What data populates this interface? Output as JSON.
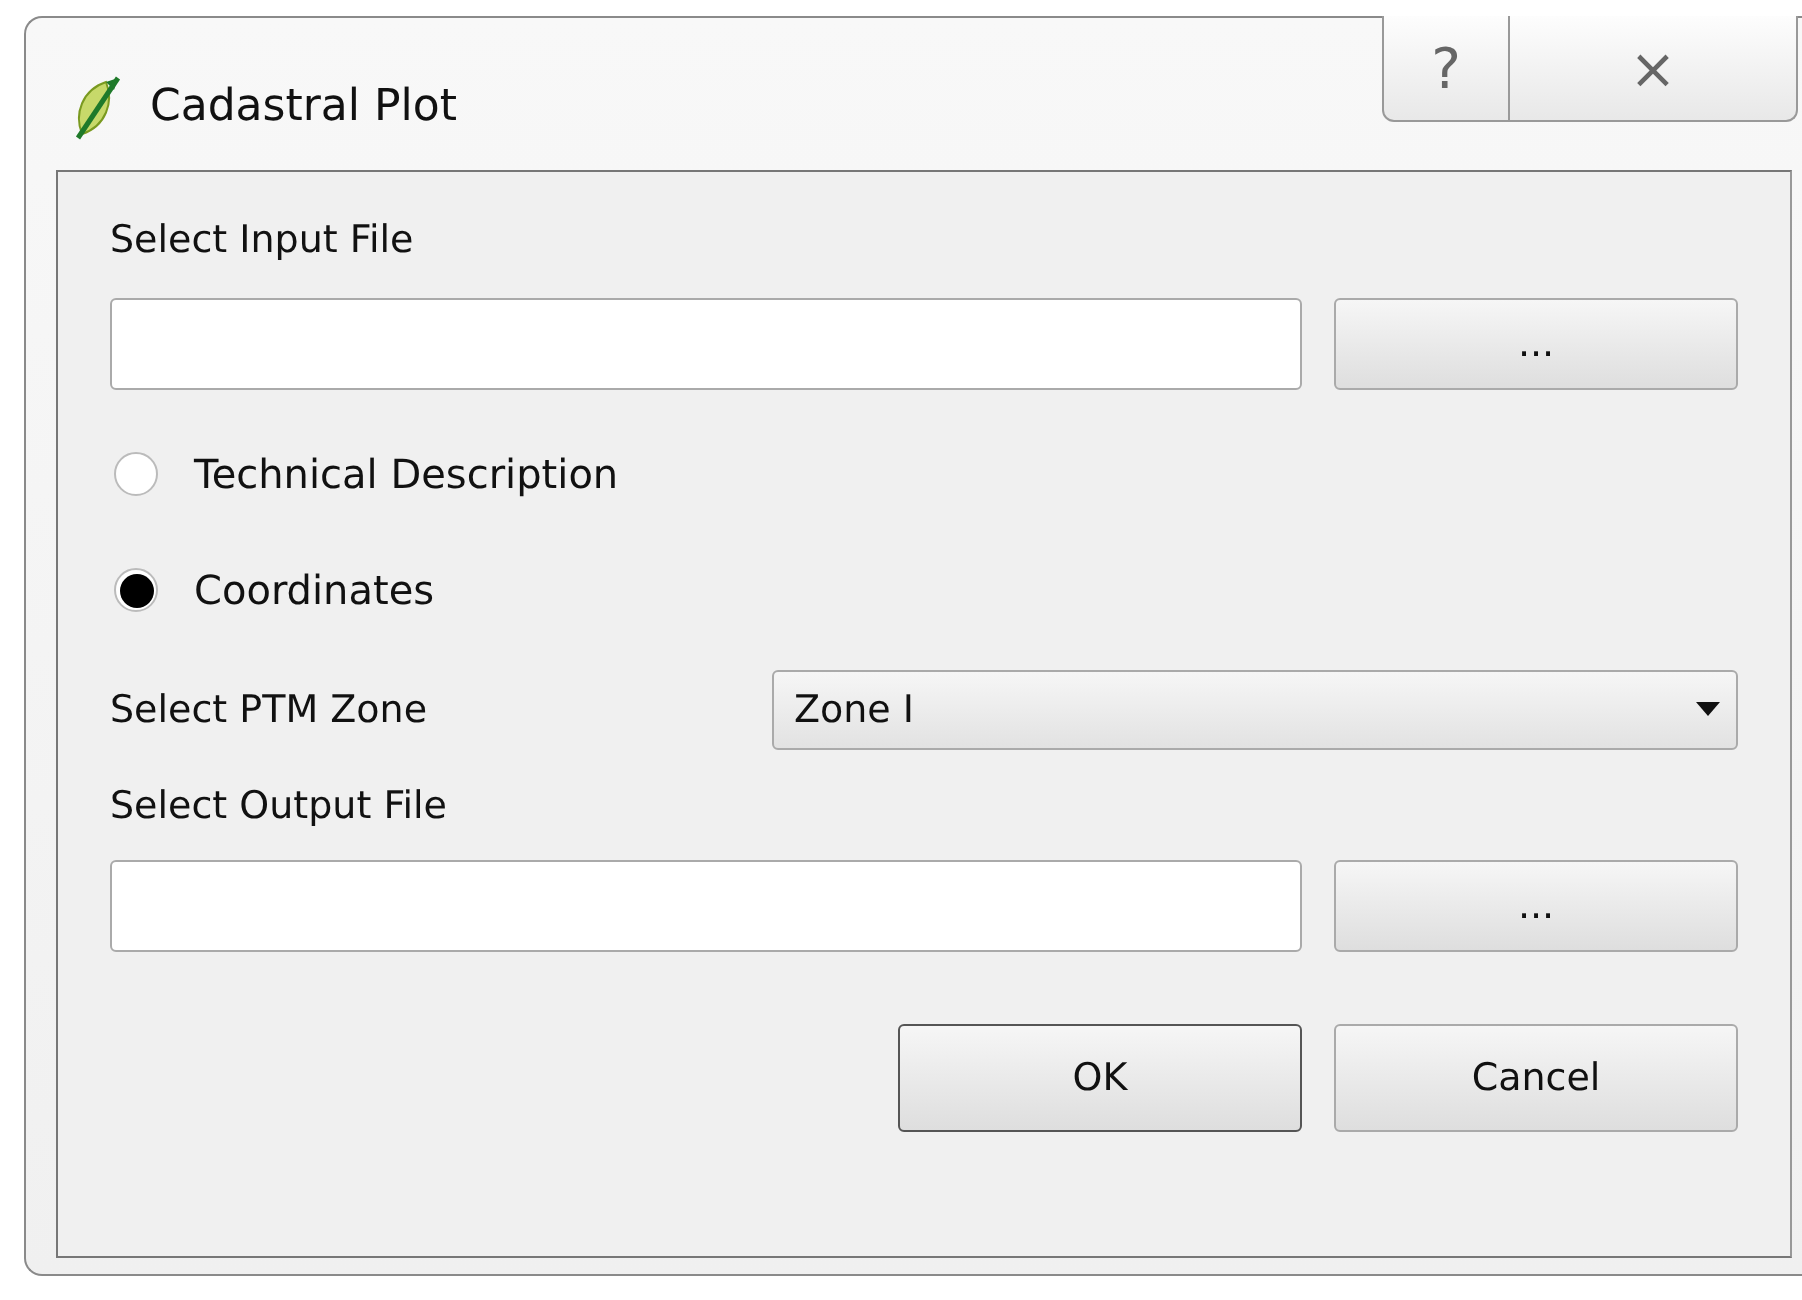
{
  "window": {
    "title": "Cadastral Plot",
    "help_button": "?",
    "close_button": "×"
  },
  "input_file": {
    "label": "Select Input File",
    "browse_button": "..."
  },
  "mode_options": [
    {
      "label": "Technical Description",
      "selected": false
    },
    {
      "label": "Coordinates",
      "selected": true
    }
  ],
  "ptm_zone": {
    "label": "Select PTM Zone",
    "value": "Zone I"
  },
  "output_file": {
    "label": "Select Output File",
    "browse_button": "..."
  },
  "buttons": [
    {
      "label": "OK",
      "kind": "default"
    },
    {
      "label": "Cancel",
      "kind": "normal"
    }
  ]
}
